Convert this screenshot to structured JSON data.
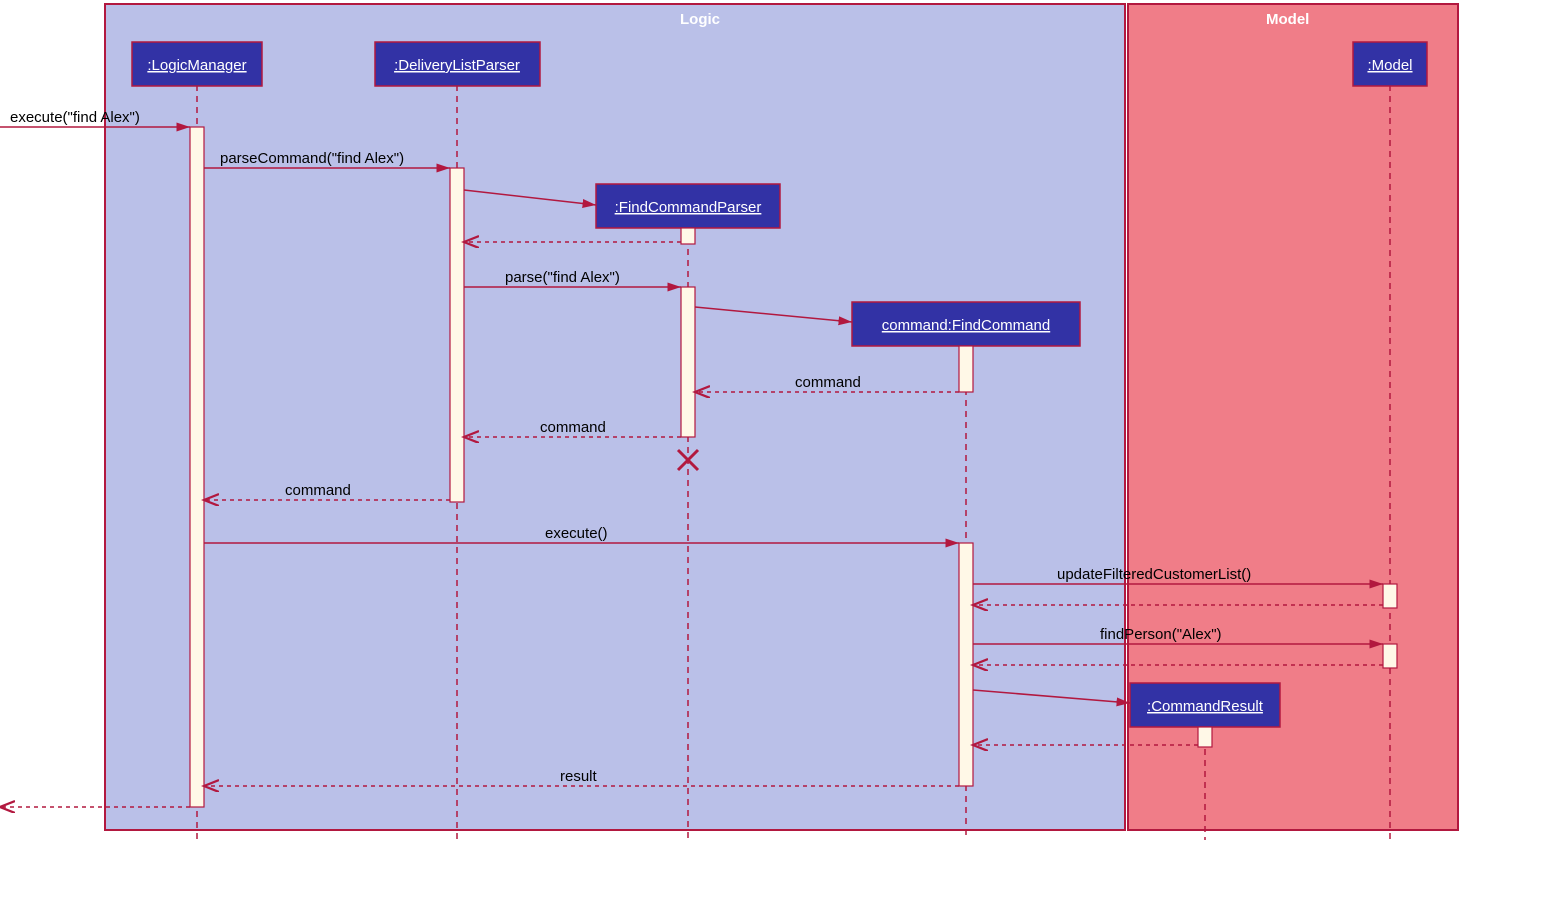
{
  "frames": {
    "logic": "Logic",
    "model": "Model"
  },
  "participants": {
    "p1": ":LogicManager",
    "p2": ":DeliveryListParser",
    "p3": ":FindCommandParser",
    "p4": "command:FindCommand",
    "p5": ":Model",
    "p6": ":CommandResult"
  },
  "messages": {
    "m1": "execute(\"find Alex\")",
    "m2": "parseCommand(\"find Alex\")",
    "m3": "parse(\"find Alex\")",
    "m4": "command",
    "m5": "command",
    "m6": "command",
    "m7": "execute()",
    "m8": "updateFilteredCustomerList()",
    "m9": "findPerson(\"Alex\")",
    "m10": "result"
  }
}
